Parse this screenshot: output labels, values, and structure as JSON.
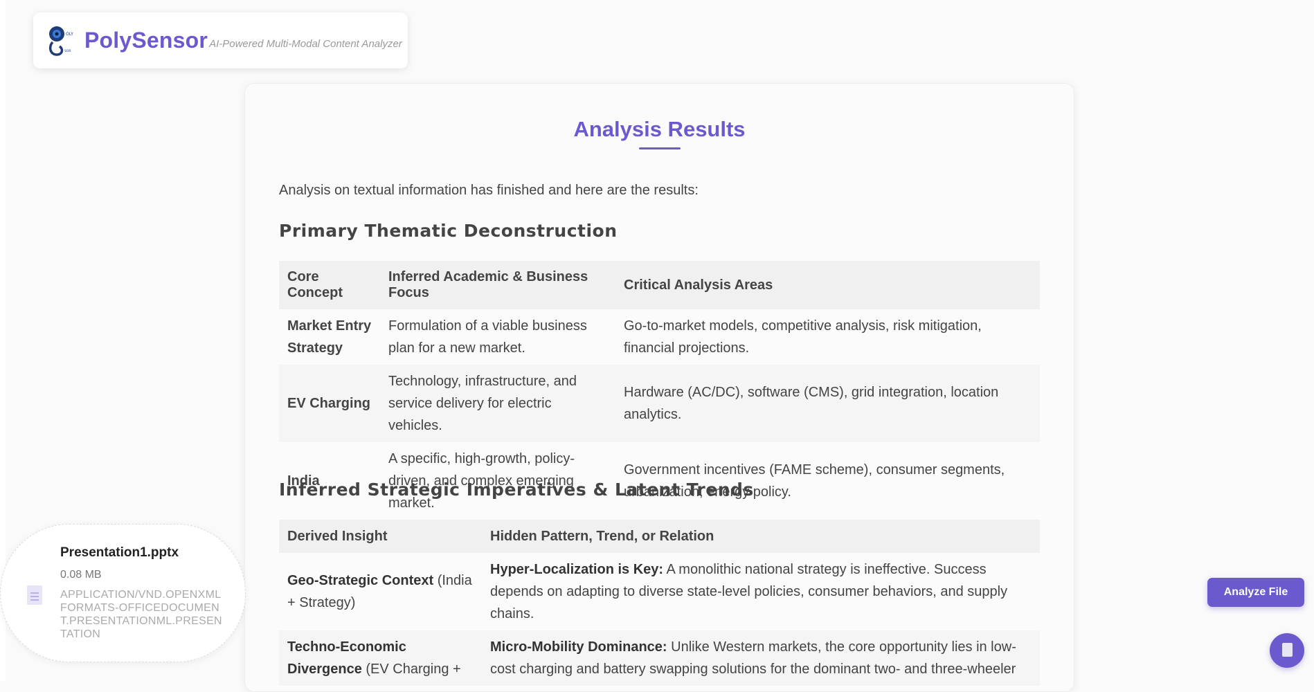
{
  "brand": {
    "name": "PolySensor",
    "tagline": "AI-Powered Multi-Modal Content Analyzer",
    "logo_text_top": "OLY",
    "logo_text_bottom": "SOR"
  },
  "results": {
    "title": "Analysis Results",
    "intro": "Analysis on textual information has finished and here are the results:"
  },
  "section1": {
    "heading": "Primary Thematic Deconstruction",
    "headers": [
      "Core Concept",
      "Inferred Academic & Business Focus",
      "Critical Analysis Areas"
    ],
    "rows": [
      [
        "Market Entry Strategy",
        "Formulation of a viable business plan for a new market.",
        "Go-to-market models, competitive analysis, risk mitigation, financial projections."
      ],
      [
        "EV Charging",
        "Technology, infrastructure, and service delivery for electric vehicles.",
        "Hardware (AC/DC), software (CMS), grid integration, location analytics."
      ],
      [
        "India",
        "A specific, high-growth, policy-driven, and complex emerging market.",
        "Government incentives (FAME scheme), consumer segments, urbanization, energy policy."
      ]
    ]
  },
  "section2": {
    "heading": "Inferred Strategic Imperatives & Latent Trends",
    "headers": [
      "Derived Insight",
      "Hidden Pattern, Trend, or Relation"
    ],
    "rows": [
      {
        "insight_bold": "Geo-Strategic Context",
        "insight_rest": " (India + Strategy)",
        "pattern_bold": "Hyper-Localization is Key:",
        "pattern_rest": " A monolithic national strategy is ineffective. Success depends on adapting to diverse state-level policies, consumer behaviors, and supply chains."
      },
      {
        "insight_bold": "Techno-Economic Divergence",
        "insight_rest": " (EV Charging +",
        "pattern_bold": "Micro-Mobility Dominance:",
        "pattern_rest": " Unlike Western markets, the core opportunity lies in low-cost charging and battery swapping solutions for the dominant two- and three-wheeler"
      }
    ]
  },
  "file": {
    "name": "Presentation1.pptx",
    "size": "0.08 MB",
    "type": "APPLICATION/VND.OPENXMLFORMATS-OFFICEDOCUMENT.PRESENTATIONML.PRESENTATION",
    "icon": "document-icon"
  },
  "actions": {
    "analyze_label": "Analyze File",
    "fab_icon": "document-icon"
  },
  "colors": {
    "accent": "#6a5acd"
  }
}
